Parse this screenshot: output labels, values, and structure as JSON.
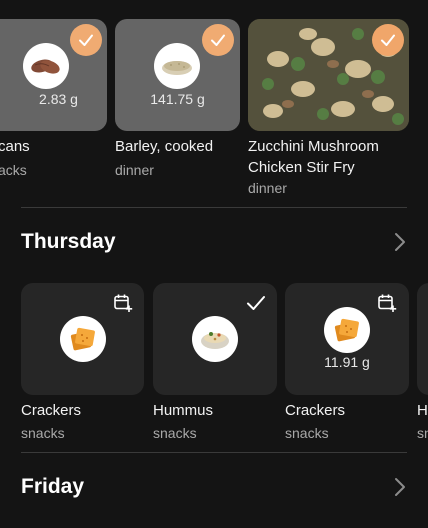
{
  "top_row": {
    "items": [
      {
        "name": "cans",
        "meal": "acks",
        "amount": "2.83 g",
        "food_icon": "pecans-icon",
        "status_icon": "check-badge-icon"
      },
      {
        "name": "Barley, cooked",
        "meal": "dinner",
        "amount": "141.75 g",
        "food_icon": "barley-icon",
        "status_icon": "check-badge-icon"
      },
      {
        "name_line1": "Zucchini Mushroom",
        "name_line2": "Chicken Stir Fry",
        "meal": "dinner",
        "food_icon": "stir-fry-photo",
        "status_icon": "check-badge-icon"
      }
    ]
  },
  "sections": [
    {
      "title": "Thursday",
      "items": [
        {
          "name": "Crackers",
          "meal": "snacks",
          "amount": "",
          "food_icon": "crackers-icon",
          "status_icon": "calendar-add-icon"
        },
        {
          "name": "Hummus",
          "meal": "snacks",
          "amount": "",
          "food_icon": "hummus-icon",
          "status_icon": "check-icon"
        },
        {
          "name": "Crackers",
          "meal": "snacks",
          "amount": "11.91 g",
          "food_icon": "crackers-icon",
          "status_icon": "calendar-add-icon"
        },
        {
          "name": "H",
          "meal": "sn",
          "food_icon": "",
          "status_icon": ""
        }
      ]
    },
    {
      "title": "Friday",
      "items": []
    }
  ],
  "colors": {
    "background": "#141414",
    "card": "#262626",
    "accent": "#f0a66a",
    "divider": "#3a3a3a"
  }
}
